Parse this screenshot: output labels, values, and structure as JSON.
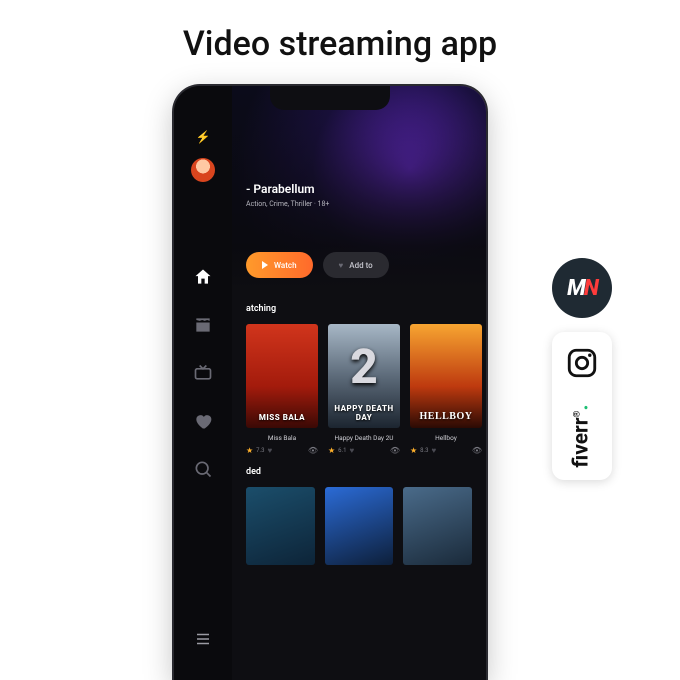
{
  "page": {
    "title": "Video streaming app"
  },
  "sidebar": {
    "nav": [
      "home",
      "clapper",
      "tv",
      "heart",
      "search"
    ],
    "active_index": 0
  },
  "hero": {
    "title_suffix": " - Parabellum",
    "meta": "Action, Crime, Thriller · 18+",
    "watch_label": "Watch",
    "add_label": "Add to"
  },
  "sections": {
    "watching": {
      "title": "atching",
      "cards": [
        {
          "poster_label": "MISS BALA",
          "title": "Miss Bala",
          "rating": "7.3",
          "views": "—"
        },
        {
          "poster_label": "HAPPY DEATH DAY",
          "big": "2",
          "title": "Happy Death Day 2U",
          "rating": "6.1",
          "views": "—"
        },
        {
          "poster_label": "HELLBOY",
          "title": "Hellboy",
          "rating": "8.3",
          "views": "—"
        }
      ]
    },
    "recommended": {
      "title": "ded"
    }
  },
  "badges": {
    "mn": {
      "m": "M",
      "n": "N"
    },
    "fiverr": "fiverr"
  }
}
